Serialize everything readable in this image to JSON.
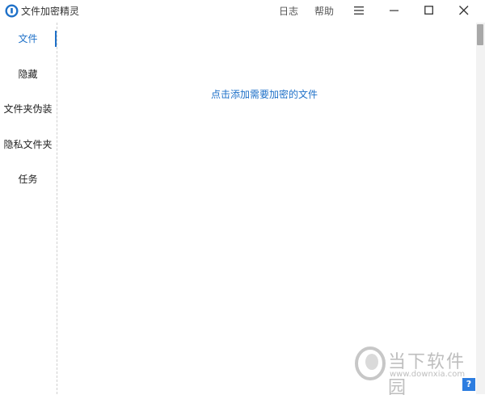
{
  "app": {
    "title": "文件加密精灵"
  },
  "topbar": {
    "log_label": "日志",
    "help_label": "帮助"
  },
  "sidebar": {
    "items": [
      {
        "label": "文件",
        "active": true
      },
      {
        "label": "隐藏"
      },
      {
        "label": "文件夹伪装"
      },
      {
        "label": "隐私文件夹"
      },
      {
        "label": "任务"
      }
    ]
  },
  "main": {
    "add_prompt": "点击添加需要加密的文件"
  },
  "watermark": {
    "brand": "当下软件园",
    "url": "www.downxia.com"
  },
  "help_badge": "?",
  "colors": {
    "accent": "#1e70c8",
    "help_badge": "#2d7de0"
  },
  "icons": [
    "app-lock-icon",
    "menu-icon",
    "minimize-icon",
    "maximize-icon",
    "close-icon"
  ]
}
